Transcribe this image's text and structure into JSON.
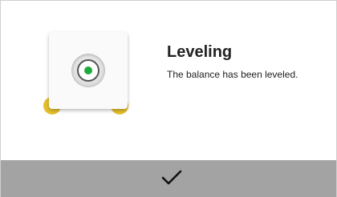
{
  "dialog": {
    "title": "Leveling",
    "message": "The balance has been leveled.",
    "level_status": "leveled",
    "bubble_color": "#1faa3f",
    "foot_color": "#e5c02d"
  },
  "footer": {
    "confirm_icon": "checkmark-icon",
    "bar_color": "#a3a3a3"
  }
}
